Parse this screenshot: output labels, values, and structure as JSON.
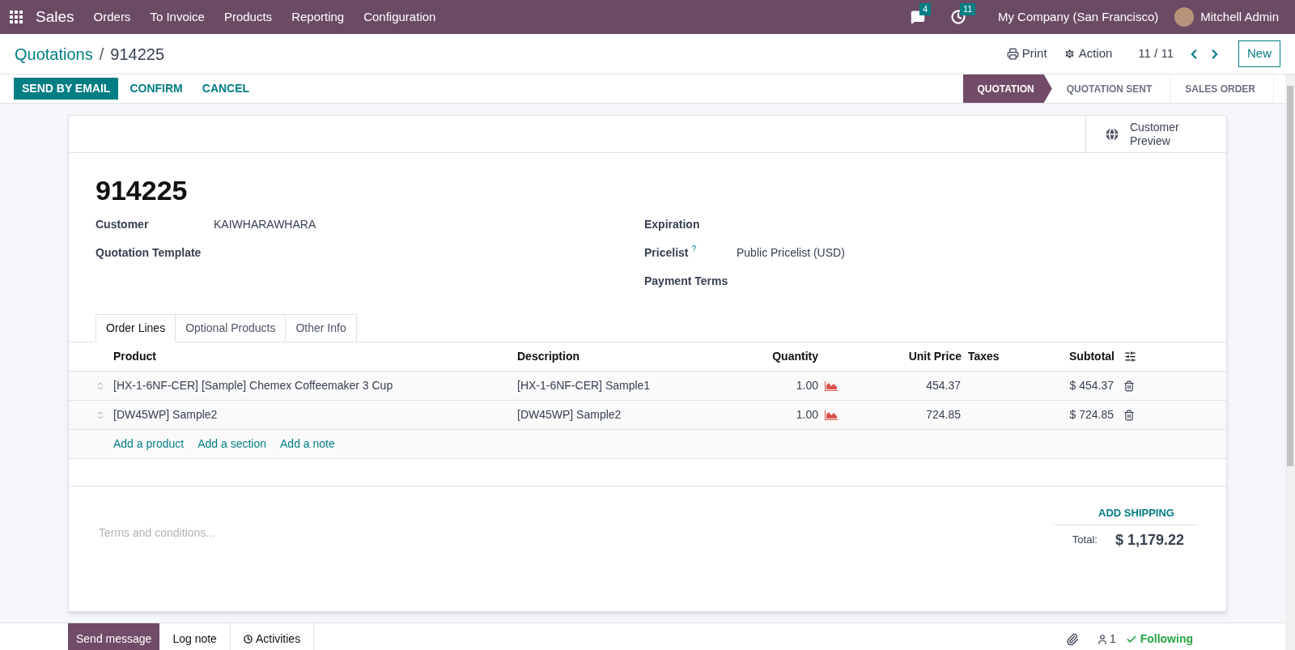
{
  "navbar": {
    "app": "Sales",
    "menu": [
      "Orders",
      "To Invoice",
      "Products",
      "Reporting",
      "Configuration"
    ],
    "messages_count": "4",
    "activities_count": "11",
    "company": "My Company (San Francisco)",
    "user": "Mitchell Admin"
  },
  "breadcrumb": {
    "parent": "Quotations",
    "separator": "/",
    "current": "914225"
  },
  "control_panel": {
    "print": "Print",
    "action": "Action",
    "pager": "11 / 11",
    "new": "New"
  },
  "actions": [
    {
      "label": "SEND BY EMAIL",
      "primary": true
    },
    {
      "label": "CONFIRM",
      "primary": false
    },
    {
      "label": "CANCEL",
      "primary": false
    }
  ],
  "stages": [
    {
      "label": "QUOTATION",
      "selected": true
    },
    {
      "label": "QUOTATION SENT",
      "selected": false
    },
    {
      "label": "SALES ORDER",
      "selected": false
    }
  ],
  "smart_button": "Customer Preview",
  "title": "914225",
  "left_fields": [
    {
      "label": "Customer",
      "value": "KAIWHARAWHARA"
    },
    {
      "label": "Quotation Template"
    }
  ],
  "right_fields": [
    {
      "label": "Expiration"
    },
    {
      "label": "Pricelist",
      "help": "?",
      "value": "Public Pricelist (USD)"
    },
    {
      "label": "Payment Terms"
    }
  ],
  "tabs": [
    {
      "label": "Order Lines",
      "selected": true
    },
    {
      "label": "Optional Products",
      "selected": false
    },
    {
      "label": "Other Info",
      "selected": false
    }
  ],
  "table": {
    "columns": [
      "Product",
      "Description",
      "Quantity",
      "Unit Price",
      "Taxes",
      "Subtotal"
    ],
    "rows": [
      {
        "product": "[HX-1-6NF-CER] [Sample] Chemex Coffeemaker 3 Cup",
        "description": "[HX-1-6NF-CER] Sample1",
        "quantity": "1.00",
        "unit_price": "454.37",
        "subtotal": "$ 454.37"
      },
      {
        "product": "[DW45WP] Sample2",
        "description": "[DW45WP] Sample2",
        "quantity": "1.00",
        "unit_price": "724.85",
        "subtotal": "$ 724.85"
      }
    ],
    "add_links": [
      "Add a product",
      "Add a section",
      "Add a note"
    ]
  },
  "terms": {
    "placeholder": "Terms and conditions..."
  },
  "add_shipping": "ADD SHIPPING",
  "total": {
    "label": "Total:",
    "value": "$ 1,179.22"
  },
  "chatter": {
    "tabs": [
      {
        "label": "Send message",
        "selected": true
      },
      {
        "label": "Log note",
        "selected": false
      },
      {
        "label": "Activities",
        "selected": false
      }
    ],
    "followers": "1",
    "following": "Following"
  }
}
